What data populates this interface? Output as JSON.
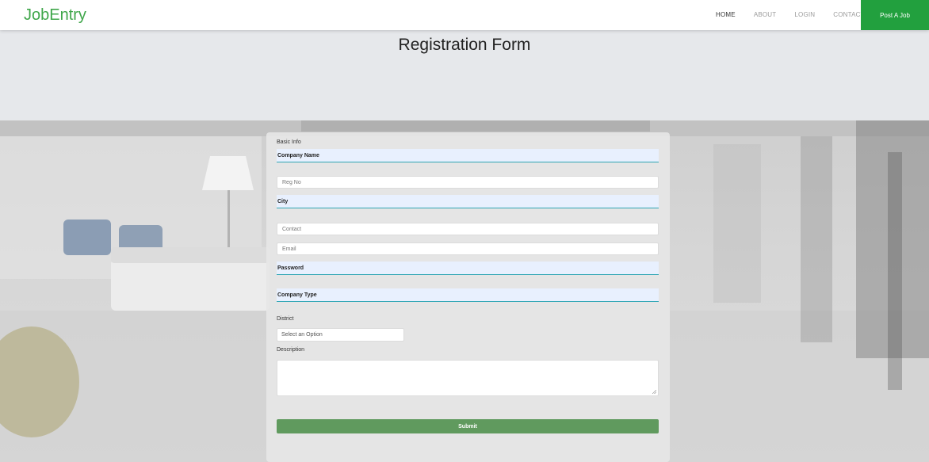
{
  "navbar": {
    "brand": "JobEntry",
    "links": [
      "HOME",
      "ABOUT",
      "LOGIN",
      "CONTACT"
    ],
    "active_link": "HOME",
    "cta": "Post A Job"
  },
  "header": {
    "title": "Registration Form"
  },
  "form": {
    "section_label": "Basic Info",
    "company_name": "Company Name",
    "reg_no_placeholder": "Reg No",
    "city": "City",
    "contact_placeholder": "Contact",
    "email_placeholder": "Email",
    "password": "Password",
    "company_type": "Company Type",
    "district_label": "District",
    "district_select": "Select an Option",
    "description_label": "Description",
    "submit_label": "Submit"
  },
  "colors": {
    "brand": "#3fa64a",
    "cta": "#22a03e",
    "submit": "#609a5e",
    "field_underline": "#2fa6b4"
  }
}
